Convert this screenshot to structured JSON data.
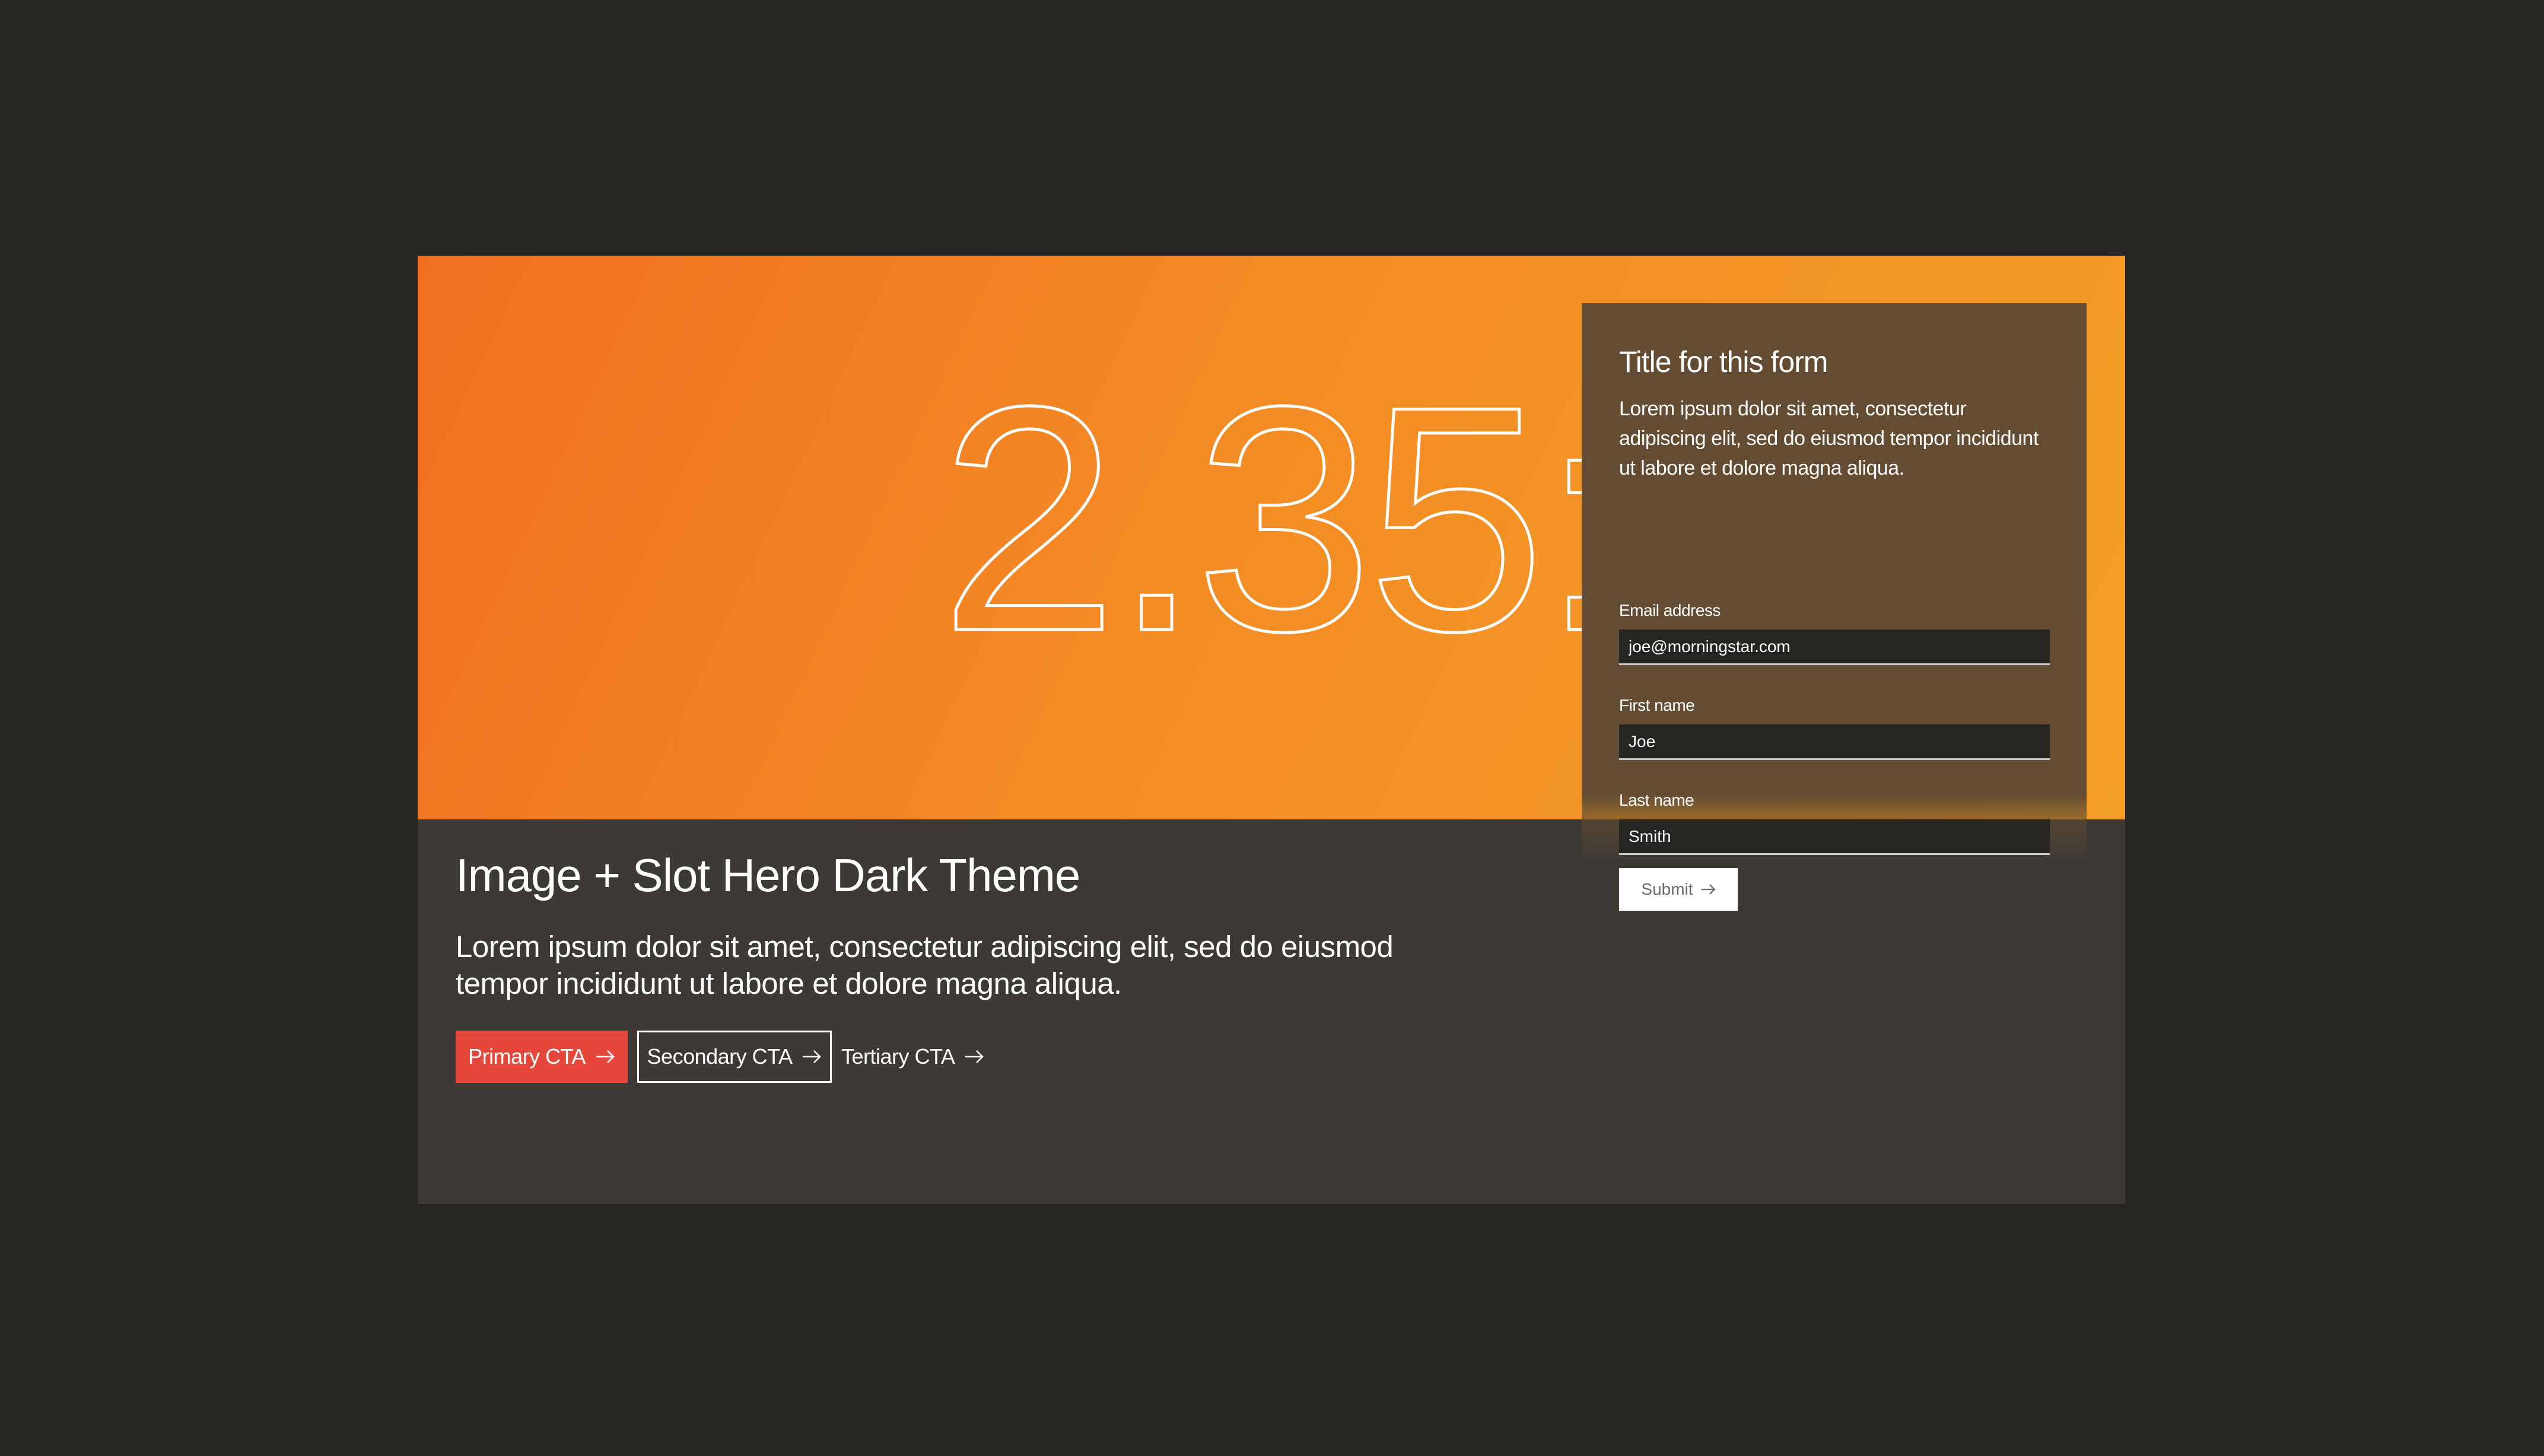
{
  "hero": {
    "ratio_text": "2.35:1",
    "title": "Image + Slot Hero Dark Theme",
    "body": "Lorem ipsum dolor sit amet, consectetur adipiscing elit, sed do eiusmod tempor incididunt ut labore et dolore magna aliqua.",
    "primary_cta": "Primary CTA",
    "secondary_cta": "Secondary CTA",
    "tertiary_cta": "Tertiary CTA",
    "colors": {
      "gradient_start": "#f26f22",
      "gradient_end": "#f3a027",
      "primary_cta": "#e7473a",
      "panel": "#634c32",
      "content_bg": "#3d3934"
    }
  },
  "form": {
    "title": "Title for this form",
    "description": "Lorem ipsum dolor sit amet, consectetur adipiscing elit, sed do eiusmod tempor incididunt ut labore et dolore magna aliqua.",
    "fields": [
      {
        "label": "Email address",
        "value": "joe@morningstar.com"
      },
      {
        "label": "First name",
        "value": "Joe"
      },
      {
        "label": "Last name",
        "value": "Smith"
      }
    ],
    "submit_label": "Submit"
  }
}
